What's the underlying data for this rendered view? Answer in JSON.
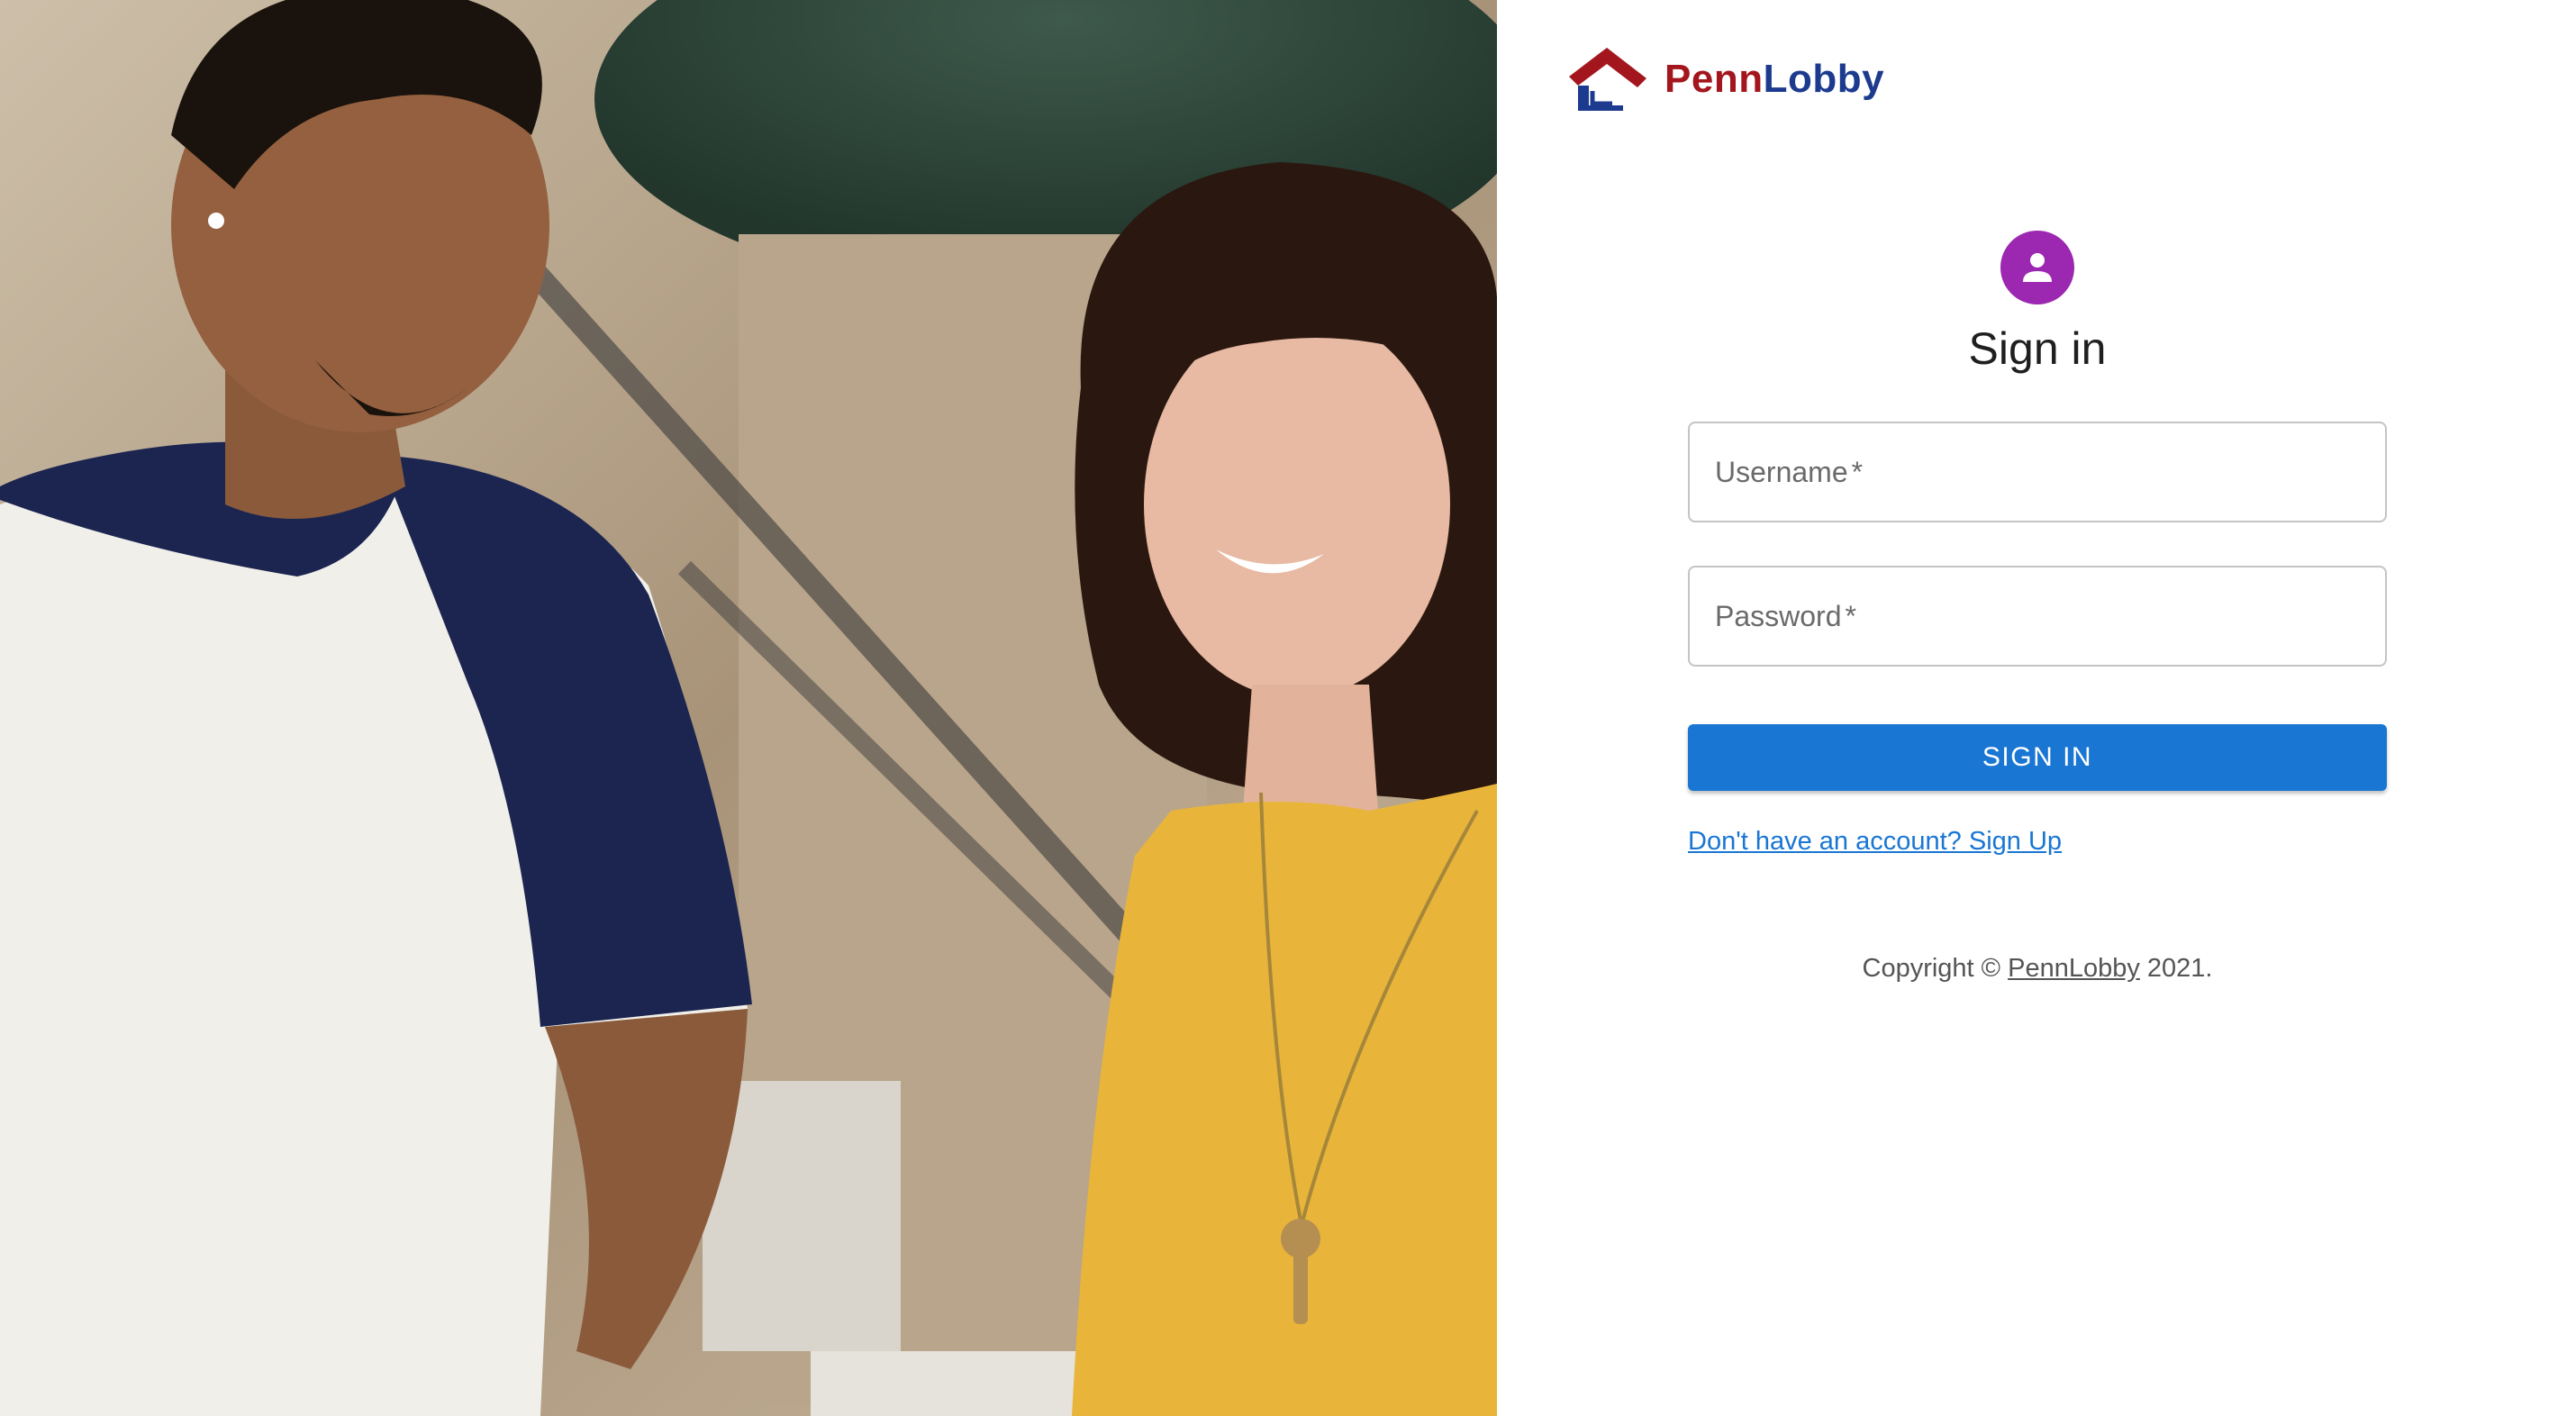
{
  "brand": {
    "name_part1": "Penn",
    "name_part2": "Lobby",
    "color_primary": "#a3161d",
    "color_secondary": "#1c3b8f"
  },
  "hero": {
    "icon": "hero-photo"
  },
  "form": {
    "avatar_icon": "person-icon",
    "avatar_color": "#9c27b0",
    "title": "Sign in",
    "username": {
      "label": "Username",
      "required_mark": "*",
      "value": ""
    },
    "password": {
      "label": "Password",
      "required_mark": "*",
      "value": ""
    },
    "submit_label": "SIGN IN",
    "submit_color": "#1976d2",
    "signup_link": "Don't have an account? Sign Up"
  },
  "footer": {
    "copyright_prefix": "Copyright ©",
    "copyright_link": "PennLobby",
    "copyright_suffix": "2021."
  }
}
